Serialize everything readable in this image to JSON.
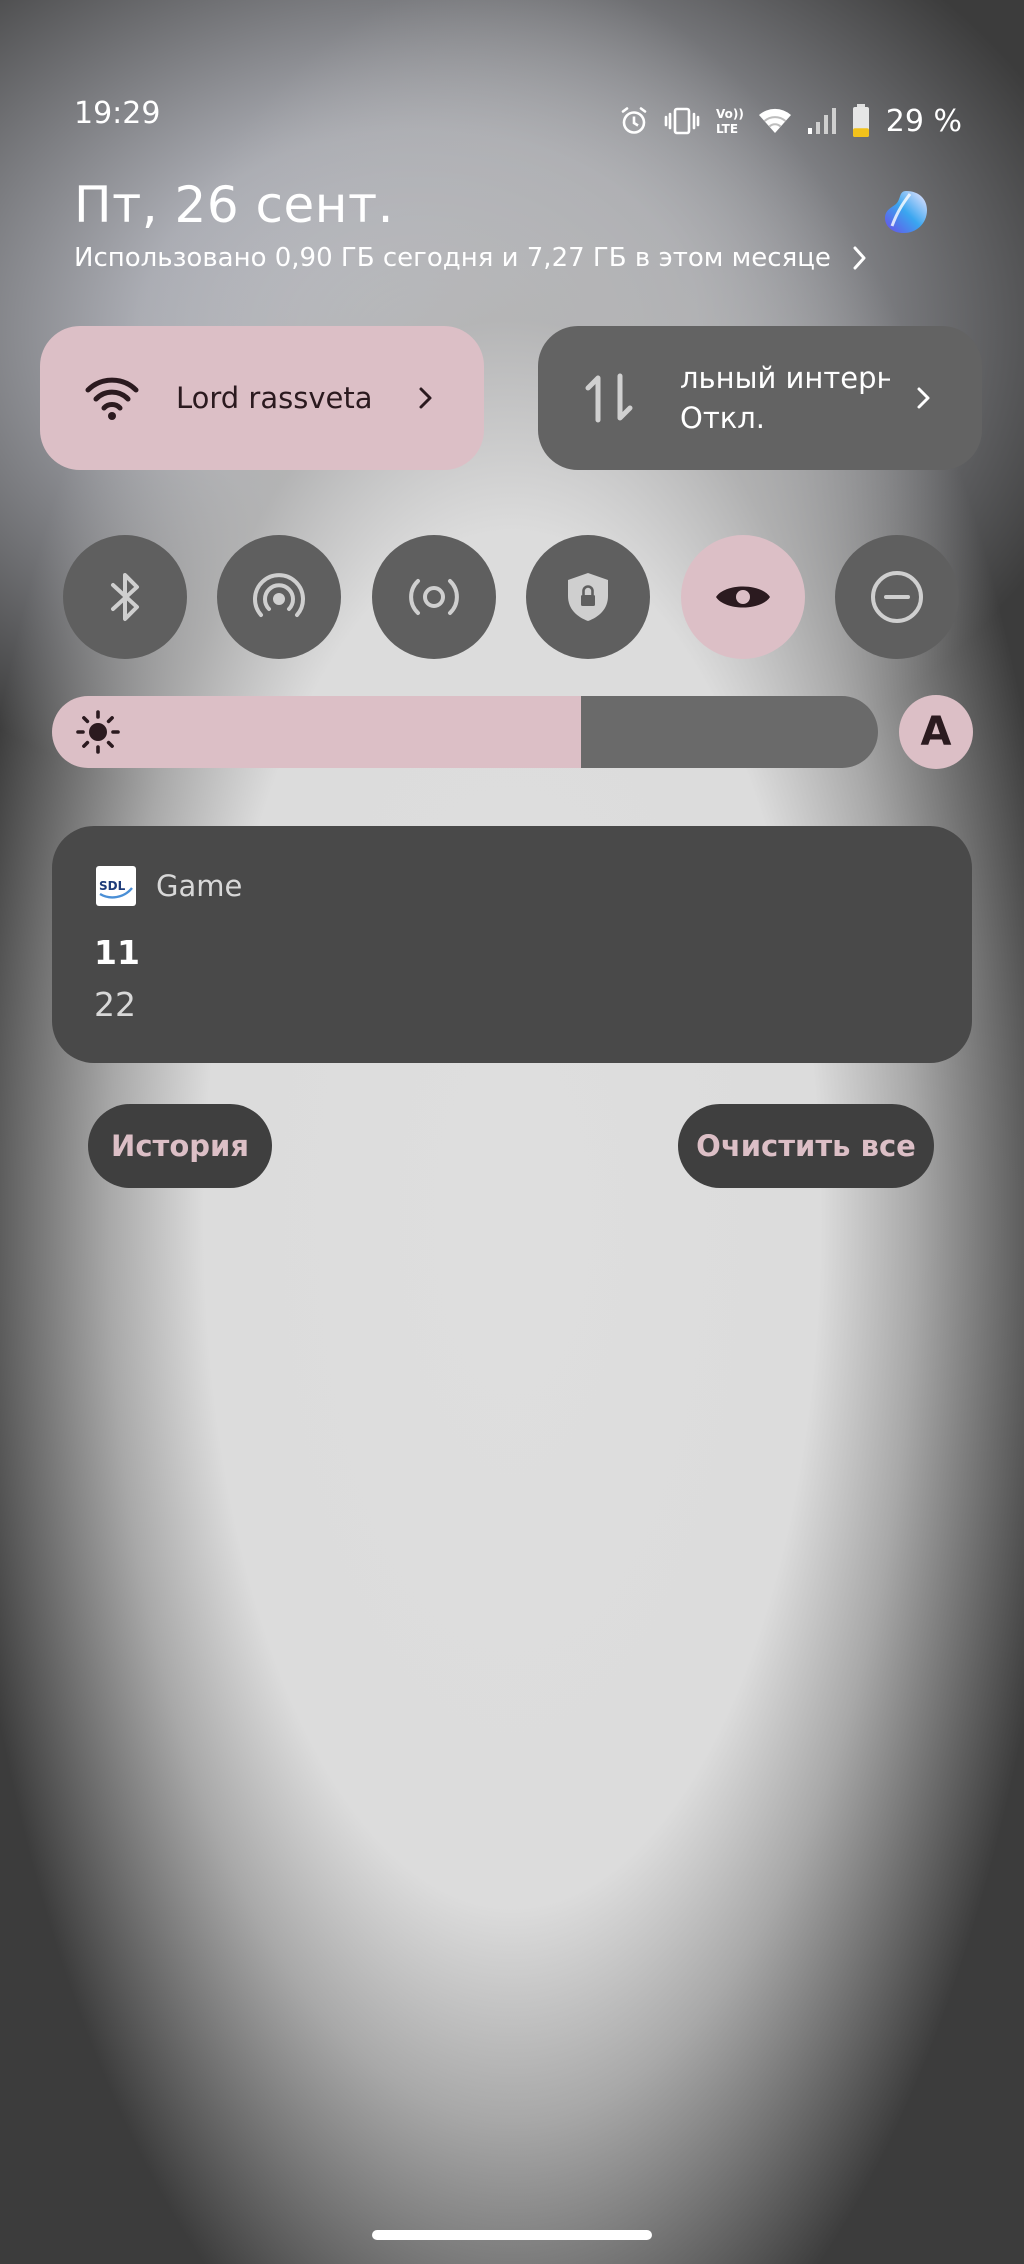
{
  "status_bar": {
    "time": "19:29",
    "battery_percent": "29 %",
    "icons": [
      "alarm-icon",
      "vibrate-icon",
      "volte-icon",
      "wifi-icon",
      "signal-icon",
      "battery-icon"
    ],
    "volte_top": "Vo))",
    "volte_bottom": "LTE",
    "battery_level": 0.29,
    "battery_color": "#f2c21b"
  },
  "header": {
    "date": "Пт, 26 сент.",
    "data_usage": "Использовано 0,90 ГБ сегодня и 7,27 ГБ в этом месяце"
  },
  "tiles": {
    "wifi": {
      "label": "Lord rassveta",
      "icon": "wifi-icon"
    },
    "mobile_data": {
      "title": "льный интерн",
      "status": "Откл.",
      "icon": "mobile-data-icon"
    }
  },
  "toggles": [
    {
      "name": "bluetooth",
      "icon": "bluetooth-icon",
      "active": false
    },
    {
      "name": "hotspot",
      "icon": "hotspot-icon",
      "active": false
    },
    {
      "name": "nfc",
      "icon": "nfc-icon",
      "active": false
    },
    {
      "name": "vpn",
      "icon": "vpn-shield-icon",
      "active": false
    },
    {
      "name": "eye-comfort",
      "icon": "eye-icon",
      "active": true
    },
    {
      "name": "do-not-disturb",
      "icon": "do-not-disturb-icon",
      "active": false
    }
  ],
  "brightness": {
    "level": 0.64,
    "icon": "sun-icon",
    "auto_label": "A"
  },
  "notification": {
    "app_name": "Game",
    "app_icon_text": "SDL",
    "title": "11",
    "body": "22"
  },
  "actions": {
    "history_label": "История",
    "clear_all_label": "Очистить все"
  },
  "colors": {
    "accent": "#dcbfc6",
    "tile_inactive": "#5f5f5f",
    "on_accent": "#2b1a1f"
  }
}
